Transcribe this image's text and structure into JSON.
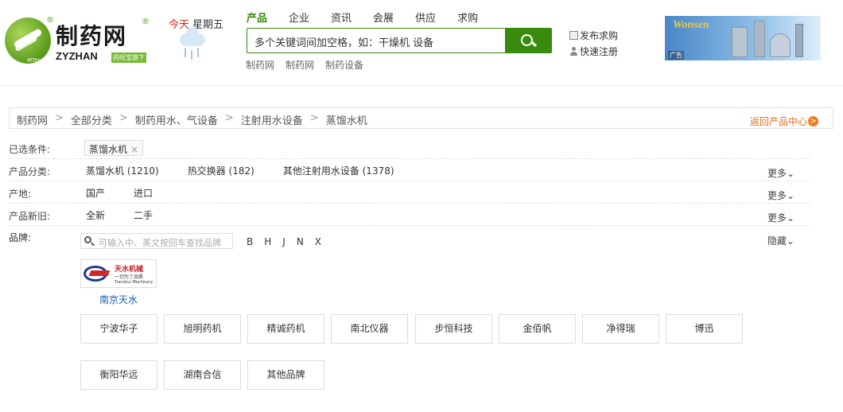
{
  "logo": {
    "cn": "制药网",
    "en": "ZYZHAN",
    "tagline": "药旺宝旗下",
    "sub": "MTech",
    "reg": "®"
  },
  "today": {
    "label": "今天",
    "weekday": "星期五"
  },
  "nav": {
    "tabs": [
      "产品",
      "企业",
      "资讯",
      "会展",
      "供应",
      "求购"
    ],
    "active": 0
  },
  "search": {
    "placeholder": "多个关键词间加空格，如：干燥机 设备"
  },
  "hot_keywords": [
    "制药网",
    "制药网",
    "制药设备"
  ],
  "quick_links": {
    "publish": "发布求购",
    "register": "快速注册"
  },
  "banner": {
    "brand": "Wonsen",
    "ad_label": "广告"
  },
  "breadcrumb": [
    "制药网",
    "全部分类",
    "制药用水、气设备",
    "注射用水设备",
    "蒸馏水机"
  ],
  "back_link": "返回产品中心",
  "filters": {
    "selected_label": "已选条件:",
    "selected_chip": "蒸馏水机",
    "category_label": "产品分类:",
    "categories": [
      "蒸馏水机 (1210)",
      "热交换器 (182)",
      "其他注射用水设备 (1378)"
    ],
    "origin_label": "产地:",
    "origins": [
      "国产",
      "进口"
    ],
    "condition_label": "产品新旧:",
    "conditions": [
      "全新",
      "二手"
    ],
    "brand_label": "品牌:",
    "more": "更多",
    "hide": "隐藏"
  },
  "brand_search": {
    "placeholder": "可输入中、英文按回车查找品牌"
  },
  "brand_letters": [
    "B",
    "H",
    "J",
    "N",
    "X"
  ],
  "featured_brand": {
    "name": "南京天水",
    "logo_cn": "天水机械",
    "logo_slogan": "一切为了品质",
    "logo_en": "Tianshui Machinery"
  },
  "brands": [
    "宁波华子",
    "旭明药机",
    "精诚药机",
    "南北仪器",
    "步恒科技",
    "金佰帆",
    "净得瑞",
    "博迅",
    "衡阳华远",
    "湖南合信",
    "其他品牌"
  ],
  "colors": {
    "brand_green": "#3a8a0e",
    "today_red": "#e0231f",
    "back_orange": "#e06c1c",
    "link_blue": "#1a5fb4"
  }
}
